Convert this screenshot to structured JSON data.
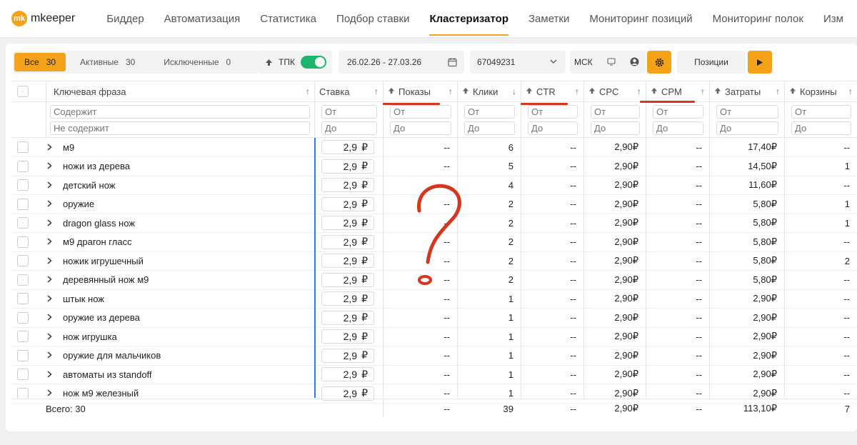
{
  "app": {
    "logo_badge": "mk",
    "logo_text": "mkeeper"
  },
  "nav": [
    {
      "label": "Биддер",
      "active": false
    },
    {
      "label": "Автоматизация",
      "active": false
    },
    {
      "label": "Статистика",
      "active": false
    },
    {
      "label": "Подбор ставки",
      "active": false
    },
    {
      "label": "Кластеризатор",
      "active": true
    },
    {
      "label": "Заметки",
      "active": false
    },
    {
      "label": "Мониторинг позиций",
      "active": false
    },
    {
      "label": "Мониторинг полок",
      "active": false
    },
    {
      "label": "Изм",
      "active": false
    }
  ],
  "toolbar": {
    "seg_all_label": "Все",
    "seg_all_count": "30",
    "seg_active_label": "Активные",
    "seg_active_count": "30",
    "seg_excluded_label": "Исключенные",
    "seg_excluded_count": "0",
    "tpk_label": "ТПК",
    "date_range": "26.02.26 - 27.03.26",
    "campaign_id": "67049231",
    "tz_label": "МСК",
    "positions_label": "Позиции"
  },
  "columns": {
    "phrase": "Ключевая фраза",
    "stavka": "Ставка",
    "shows": "Показы",
    "clicks": "Клики",
    "ctr": "CTR",
    "cpc": "CPC",
    "cpm": "CPM",
    "costs": "Затраты",
    "carts": "Корзины"
  },
  "filters": {
    "contains": "Содержит",
    "not_contains": "Не содержит",
    "from": "От",
    "to": "До"
  },
  "rows": [
    {
      "phrase": "м9",
      "stavka": "2,9",
      "shows": "--",
      "clicks": "6",
      "ctr": "--",
      "cpc": "2,90₽",
      "cpm": "--",
      "costs": "17,40₽",
      "carts": "--"
    },
    {
      "phrase": "ножи из дерева",
      "stavka": "2,9",
      "shows": "--",
      "clicks": "5",
      "ctr": "--",
      "cpc": "2,90₽",
      "cpm": "--",
      "costs": "14,50₽",
      "carts": "1"
    },
    {
      "phrase": "детский нож",
      "stavka": "2,9",
      "shows": "--",
      "clicks": "4",
      "ctr": "--",
      "cpc": "2,90₽",
      "cpm": "--",
      "costs": "11,60₽",
      "carts": "--"
    },
    {
      "phrase": "оружие",
      "stavka": "2,9",
      "shows": "--",
      "clicks": "2",
      "ctr": "--",
      "cpc": "2,90₽",
      "cpm": "--",
      "costs": "5,80₽",
      "carts": "1"
    },
    {
      "phrase": "dragon glass нож",
      "stavka": "2,9",
      "shows": "--",
      "clicks": "2",
      "ctr": "--",
      "cpc": "2,90₽",
      "cpm": "--",
      "costs": "5,80₽",
      "carts": "1"
    },
    {
      "phrase": "м9 драгон гласс",
      "stavka": "2,9",
      "shows": "--",
      "clicks": "2",
      "ctr": "--",
      "cpc": "2,90₽",
      "cpm": "--",
      "costs": "5,80₽",
      "carts": "--"
    },
    {
      "phrase": "ножик игрушечный",
      "stavka": "2,9",
      "shows": "--",
      "clicks": "2",
      "ctr": "--",
      "cpc": "2,90₽",
      "cpm": "--",
      "costs": "5,80₽",
      "carts": "2"
    },
    {
      "phrase": "деревянный нож м9",
      "stavka": "2,9",
      "shows": "--",
      "clicks": "2",
      "ctr": "--",
      "cpc": "2,90₽",
      "cpm": "--",
      "costs": "5,80₽",
      "carts": "--"
    },
    {
      "phrase": "штык нож",
      "stavka": "2,9",
      "shows": "--",
      "clicks": "1",
      "ctr": "--",
      "cpc": "2,90₽",
      "cpm": "--",
      "costs": "2,90₽",
      "carts": "--"
    },
    {
      "phrase": "оружие из дерева",
      "stavka": "2,9",
      "shows": "--",
      "clicks": "1",
      "ctr": "--",
      "cpc": "2,90₽",
      "cpm": "--",
      "costs": "2,90₽",
      "carts": "--"
    },
    {
      "phrase": "нож игрушка",
      "stavka": "2,9",
      "shows": "--",
      "clicks": "1",
      "ctr": "--",
      "cpc": "2,90₽",
      "cpm": "--",
      "costs": "2,90₽",
      "carts": "--"
    },
    {
      "phrase": "оружие для мальчиков",
      "stavka": "2,9",
      "shows": "--",
      "clicks": "1",
      "ctr": "--",
      "cpc": "2,90₽",
      "cpm": "--",
      "costs": "2,90₽",
      "carts": "--"
    },
    {
      "phrase": "автоматы из standoff",
      "stavka": "2,9",
      "shows": "--",
      "clicks": "1",
      "ctr": "--",
      "cpc": "2,90₽",
      "cpm": "--",
      "costs": "2,90₽",
      "carts": "--"
    },
    {
      "phrase": "нож м9 железный",
      "stavka": "2,9",
      "shows": "--",
      "clicks": "1",
      "ctr": "--",
      "cpc": "2,90₽",
      "cpm": "--",
      "costs": "2,90₽",
      "carts": "--"
    }
  ],
  "totals": {
    "label": "Всего: 30",
    "shows": "--",
    "clicks": "39",
    "ctr": "--",
    "cpc": "2,90₽",
    "cpm": "--",
    "costs": "113,10₽",
    "carts": "7"
  },
  "stavka_currency": "₽",
  "annotation": {
    "mark": "?",
    "color": "#d4361f"
  },
  "colors": {
    "accent": "#f4a21a",
    "toggle_on": "#1db56b",
    "sort_blue": "#2f7de1"
  }
}
